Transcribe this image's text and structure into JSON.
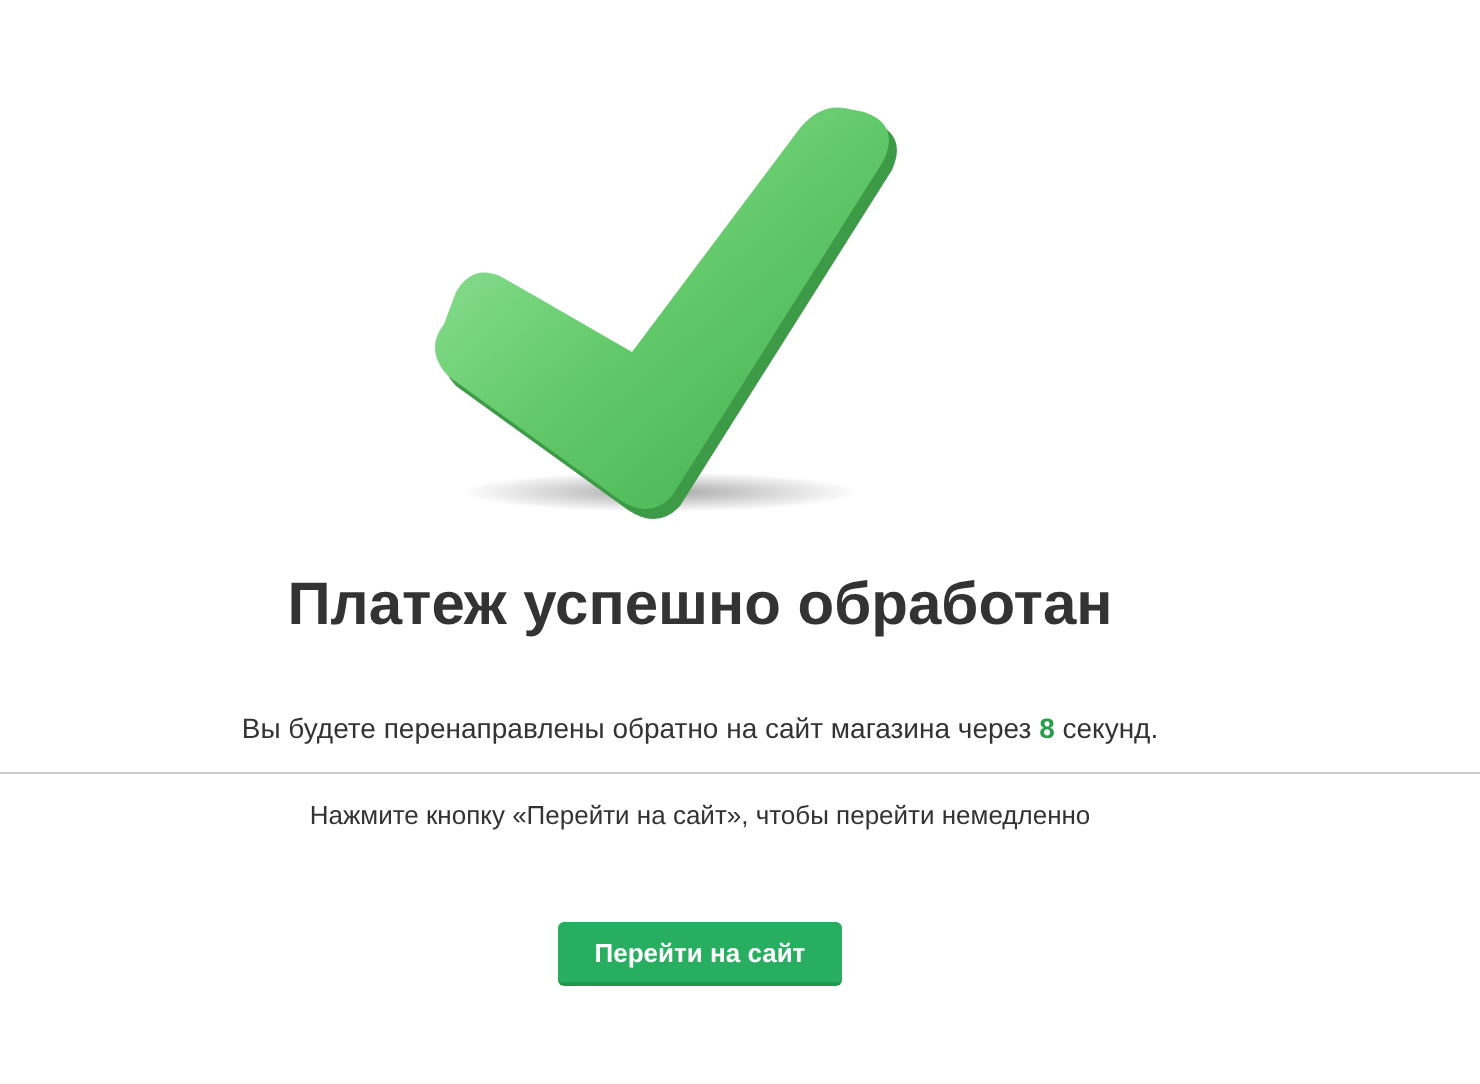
{
  "title": "Платеж успешно обработан",
  "redirect_message": "Вы будете перенаправлены обратно на сайт магазина через **8** секунд.",
  "hint": "Нажмите кнопку «Перейти на сайт», чтобы перейти немедленно",
  "button": {
    "label": "Перейти на сайт"
  }
}
